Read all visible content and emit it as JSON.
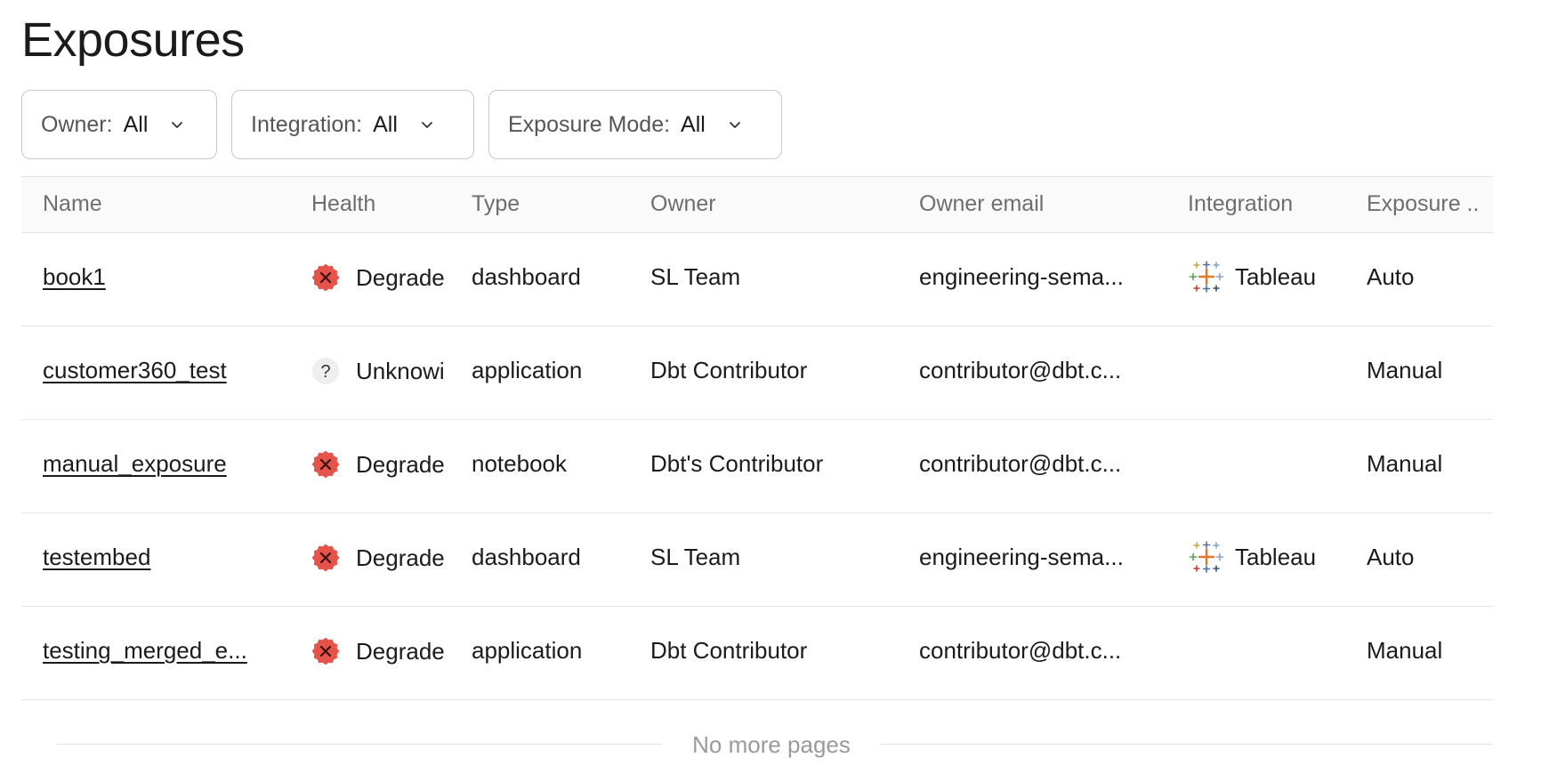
{
  "page": {
    "title": "Exposures"
  },
  "filters": [
    {
      "label": "Owner:",
      "value": "All"
    },
    {
      "label": "Integration:",
      "value": "All"
    },
    {
      "label": "Exposure Mode:",
      "value": "All"
    }
  ],
  "table": {
    "columns": [
      "Name",
      "Health",
      "Type",
      "Owner",
      "Owner email",
      "Integration",
      "Exposure .."
    ],
    "rows": [
      {
        "name": "book1",
        "health": "Degrade",
        "health_icon": "degraded-icon",
        "type": "dashboard",
        "owner": "SL Team",
        "email": "engineering-sema...",
        "integration": "Tableau",
        "integration_icon": "tableau-icon",
        "mode": "Auto"
      },
      {
        "name": "customer360_test",
        "health": "Unknowi",
        "health_icon": "unknown-icon",
        "type": "application",
        "owner": "Dbt Contributor",
        "email": "contributor@dbt.c...",
        "integration": "",
        "integration_icon": "",
        "mode": "Manual"
      },
      {
        "name": "manual_exposure",
        "health": "Degrade",
        "health_icon": "degraded-icon",
        "type": "notebook",
        "owner": "Dbt's Contributor",
        "email": "contributor@dbt.c...",
        "integration": "",
        "integration_icon": "",
        "mode": "Manual"
      },
      {
        "name": "testembed",
        "health": "Degrade",
        "health_icon": "degraded-icon",
        "type": "dashboard",
        "owner": "SL Team",
        "email": "engineering-sema...",
        "integration": "Tableau",
        "integration_icon": "tableau-icon",
        "mode": "Auto"
      },
      {
        "name": "testing_merged_e...",
        "health": "Degrade",
        "health_icon": "degraded-icon",
        "type": "application",
        "owner": "Dbt Contributor",
        "email": "contributor@dbt.c...",
        "integration": "",
        "integration_icon": "",
        "mode": "Manual"
      }
    ]
  },
  "footer": {
    "text": "No more pages"
  },
  "colors": {
    "degraded": "#e5534b",
    "unknown_bg": "#eeeeee",
    "border": "#c8c8c8",
    "header_text": "#6e6e6e",
    "muted": "#9a9a9a"
  }
}
